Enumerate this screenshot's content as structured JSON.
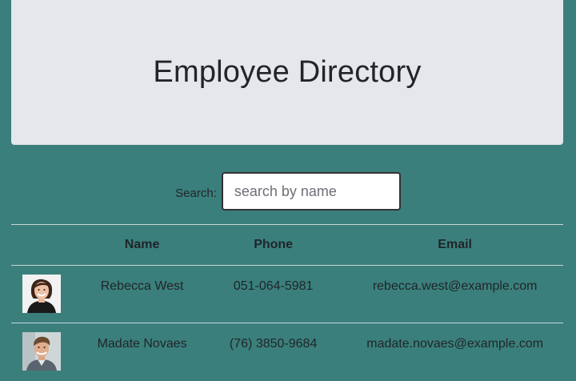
{
  "header": {
    "title": "Employee Directory"
  },
  "search": {
    "label": "Search:",
    "placeholder": "search by name",
    "value": ""
  },
  "table": {
    "columns": [
      "",
      "Name",
      "Phone",
      "Email"
    ],
    "rows": [
      {
        "name": "Rebecca West",
        "phone": "051-064-5981",
        "email": "rebecca.west@example.com",
        "avatar_icon": "woman-portrait-photo"
      },
      {
        "name": "Madate Novaes",
        "phone": "(76) 3850-9684",
        "email": "madate.novaes@example.com",
        "avatar_icon": "man-portrait-photo"
      }
    ]
  },
  "colors": {
    "background": "#3a7f7c",
    "header_bg": "#e5e7ec",
    "text": "#212529"
  }
}
